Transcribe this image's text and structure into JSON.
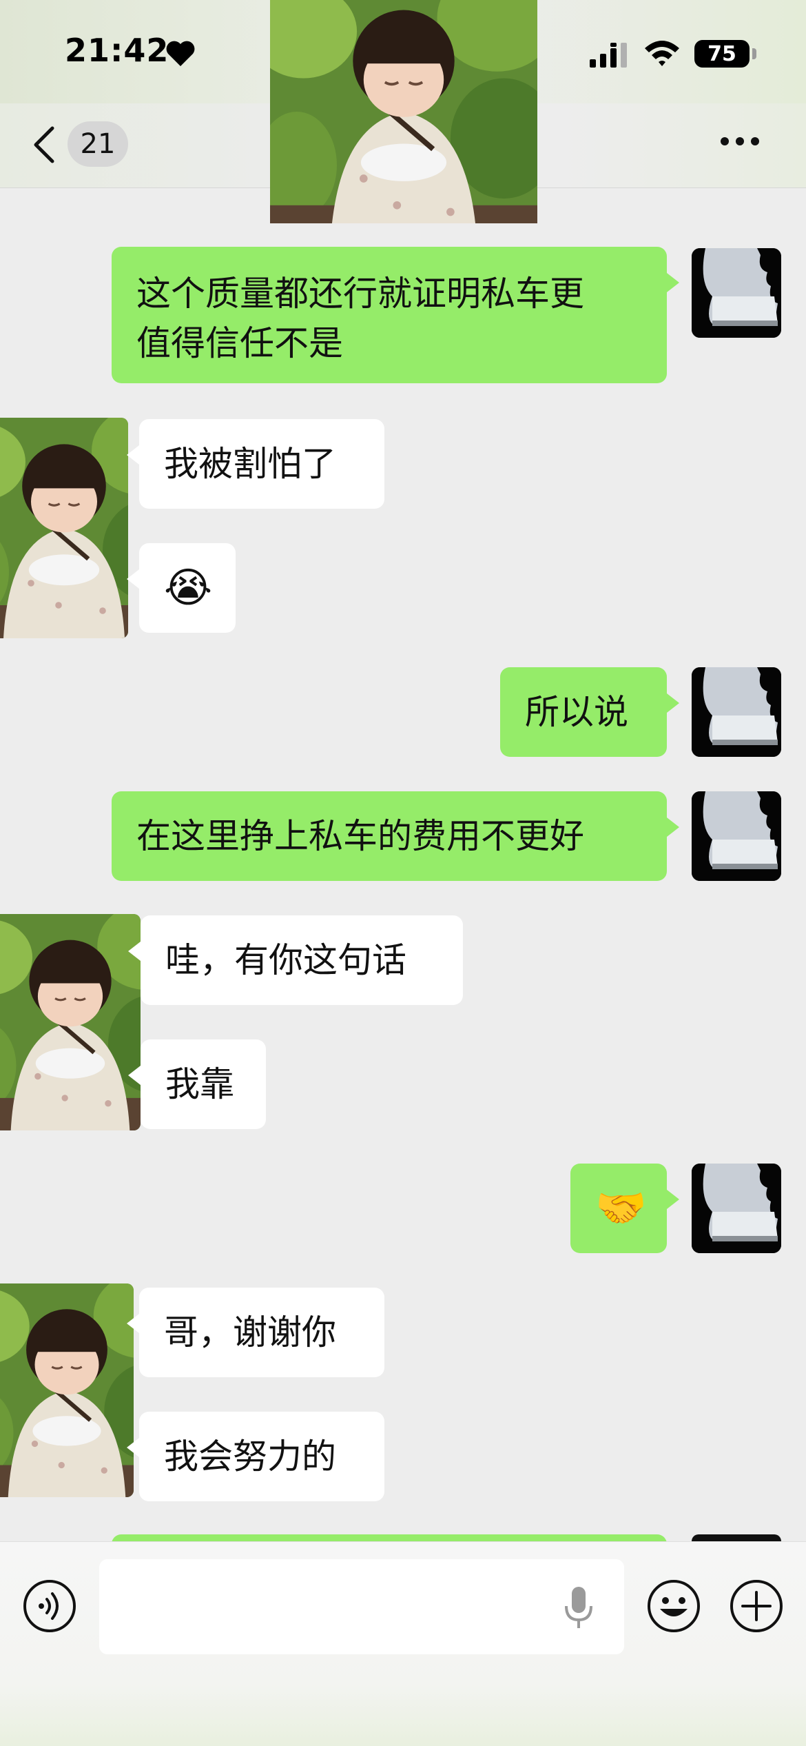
{
  "status_bar": {
    "time": "21:42",
    "battery": "75"
  },
  "header": {
    "unread_count": "21",
    "back_icon": "chevron-left-icon",
    "more_icon": "more-dots-icon"
  },
  "messages": [
    {
      "side": "out",
      "lines": [
        "这个质量都还行就证明私车更",
        "值得信任不是"
      ]
    },
    {
      "side": "in",
      "text": "我被割怕了"
    },
    {
      "side": "in",
      "text": "😭"
    },
    {
      "side": "out",
      "text": "所以说"
    },
    {
      "side": "out",
      "text": "在这里挣上私车的费用不更好"
    },
    {
      "side": "in",
      "text": "哇，有你这句话"
    },
    {
      "side": "in",
      "text": "我靠"
    },
    {
      "side": "out",
      "text": "🤝"
    },
    {
      "side": "in",
      "text": "哥，谢谢你"
    },
    {
      "side": "in",
      "text": "我会努力的"
    }
  ],
  "input_bar": {
    "placeholder": "",
    "voice_icon": "voice-wave-icon",
    "mic_icon": "microphone-icon",
    "emoji_icon": "smiley-icon",
    "plus_icon": "plus-circle-icon"
  },
  "colors": {
    "outgoing_bubble": "#95ec69",
    "incoming_bubble": "#ffffff",
    "chat_background": "#ededed"
  }
}
